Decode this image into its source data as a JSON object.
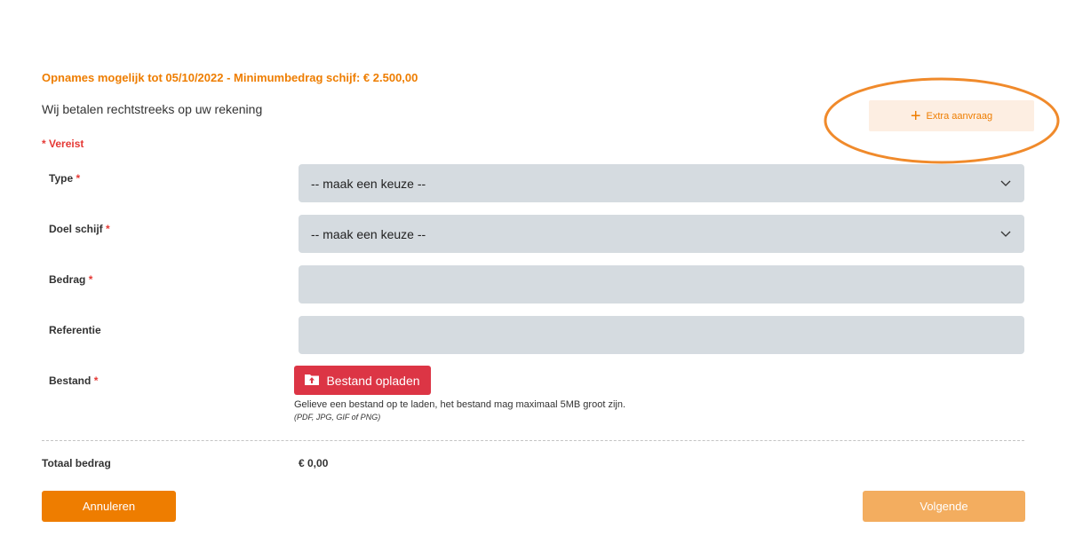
{
  "header": {
    "headline": "Opnames mogelijk tot 05/10/2022 - Minimumbedrag schijf: € 2.500,00",
    "intro": "Wij betalen rechtstreeks op uw rekening",
    "extra_request_label": "Extra aanvraag"
  },
  "form": {
    "required_note": "* Vereist",
    "required_marker": "*",
    "type": {
      "label": "Type",
      "value": "-- maak een keuze --"
    },
    "purpose": {
      "label": "Doel schijf",
      "value": "-- maak een keuze --"
    },
    "amount": {
      "label": "Bedrag",
      "value": ""
    },
    "reference": {
      "label": "Referentie",
      "value": ""
    },
    "file": {
      "label": "Bestand",
      "button_label": "Bestand opladen",
      "help_text": "Gelieve een bestand op te laden, het bestand mag maximaal 5MB groot zijn.",
      "formats": "(PDF, JPG, GIF of PNG)"
    }
  },
  "totals": {
    "label": "Totaal bedrag",
    "value": "€ 0,00"
  },
  "actions": {
    "cancel_label": "Annuleren",
    "next_label": "Volgende"
  },
  "colors": {
    "accent": "#ee7d00",
    "danger": "#dc3545",
    "field_bg": "#d5dbe0",
    "annotation": "#f08a2b"
  },
  "icons": [
    "plus-icon",
    "chevron-down-icon",
    "upload-icon"
  ]
}
